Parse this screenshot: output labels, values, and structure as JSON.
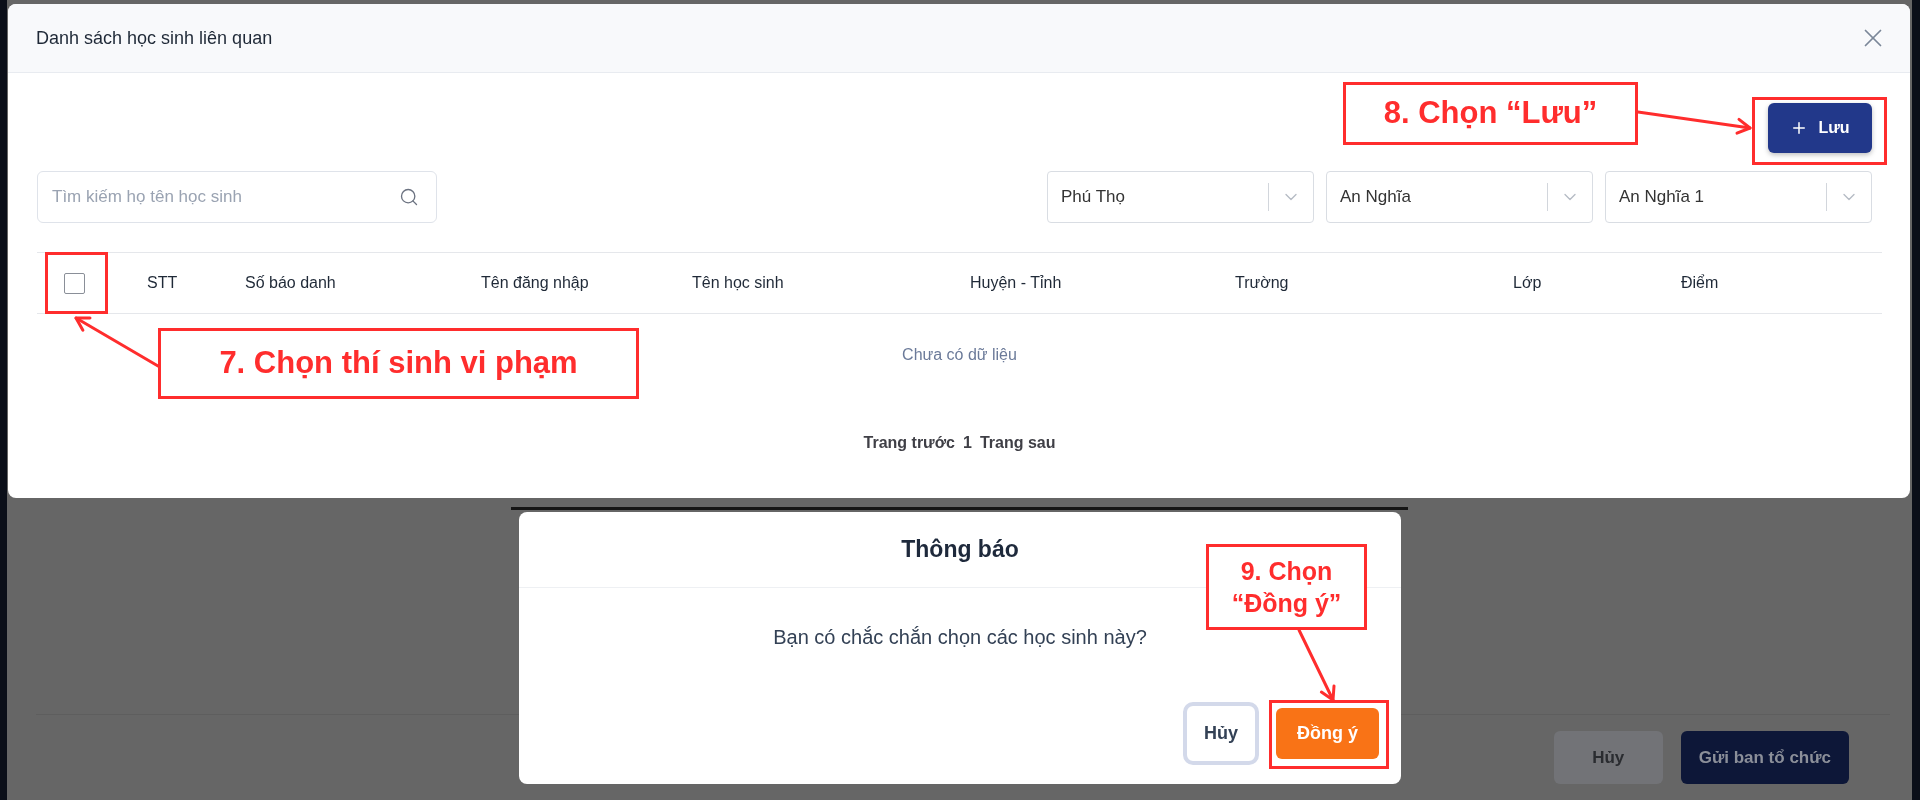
{
  "modal": {
    "title": "Danh sách học sinh liên quan",
    "save_button": {
      "label": "Lưu"
    },
    "search": {
      "placeholder": "Tìm kiếm họ tên học sinh"
    },
    "filters": [
      {
        "value": "Phú Thọ"
      },
      {
        "value": "An Nghĩa"
      },
      {
        "value": "An Nghĩa 1"
      }
    ],
    "table": {
      "select_all": {
        "checked": false
      },
      "columns": [
        "STT",
        "Số báo danh",
        "Tên đăng nhập",
        "Tên học sinh",
        "Huyện - Tỉnh",
        "Trường",
        "Lớp",
        "Điểm"
      ],
      "empty_text": "Chưa có dữ liệu"
    },
    "pagination": {
      "previous": "Trang trước",
      "page": "1",
      "next": "Trang sau"
    }
  },
  "dialog": {
    "title": "Thông báo",
    "message": "Bạn có chắc chắn chọn các học sinh này?",
    "buttons": [
      {
        "label": "Hủy",
        "kind": "secondary"
      },
      {
        "label": "Đồng ý",
        "kind": "primary"
      }
    ]
  },
  "background": {
    "buttons": [
      {
        "label": "Hủy",
        "kind": "secondary"
      },
      {
        "label": "Gửi ban tổ chức",
        "kind": "primary"
      }
    ]
  },
  "annotations": [
    {
      "text": "7. Chọn thí sinh vi phạm"
    },
    {
      "text": "8. Chọn “Lưu”"
    },
    {
      "text": "9. Chọn “Đồng ý”"
    }
  ]
}
